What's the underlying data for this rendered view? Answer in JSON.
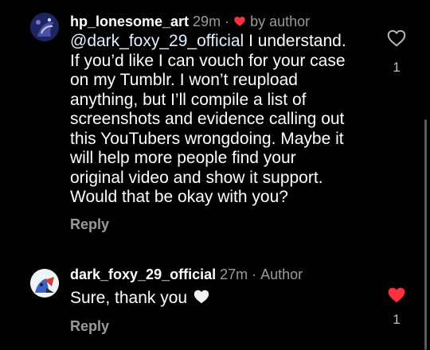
{
  "comments": [
    {
      "username": "hp_lonesome_art",
      "time": "29m",
      "separator": "·",
      "by_author_label": "by author",
      "mention": "@dark_foxy_29_official",
      "body_lines": [
        " I understand.",
        "If you’d like I can vouch for your case",
        "on my Tumblr. I won’t reupload",
        "anything, but I’ll compile a list of",
        "screenshots and evidence calling out",
        "this YouTubers wrongdoing. Maybe it",
        "will help more people find your",
        "original video and show it support.",
        "Would that be okay with you?"
      ],
      "reply_label": "Reply",
      "like_count": "1",
      "liked": false
    },
    {
      "username": "dark_foxy_29_official",
      "time": "27m",
      "separator": "·",
      "author_label": "Author",
      "body": "Sure, thank you",
      "reply_label": "Reply",
      "like_count": "1",
      "liked": true
    }
  ],
  "colors": {
    "background": "#000000",
    "text": "#ffffff",
    "muted": "#9a9a9a",
    "like_red": "#ff3040",
    "heart_emoji": "#f2f2f2"
  },
  "icons": {
    "like": "heart-outline-icon",
    "liked": "heart-filled-icon",
    "by_author": "red-heart-icon",
    "emoji": "white-heart-emoji-icon"
  }
}
